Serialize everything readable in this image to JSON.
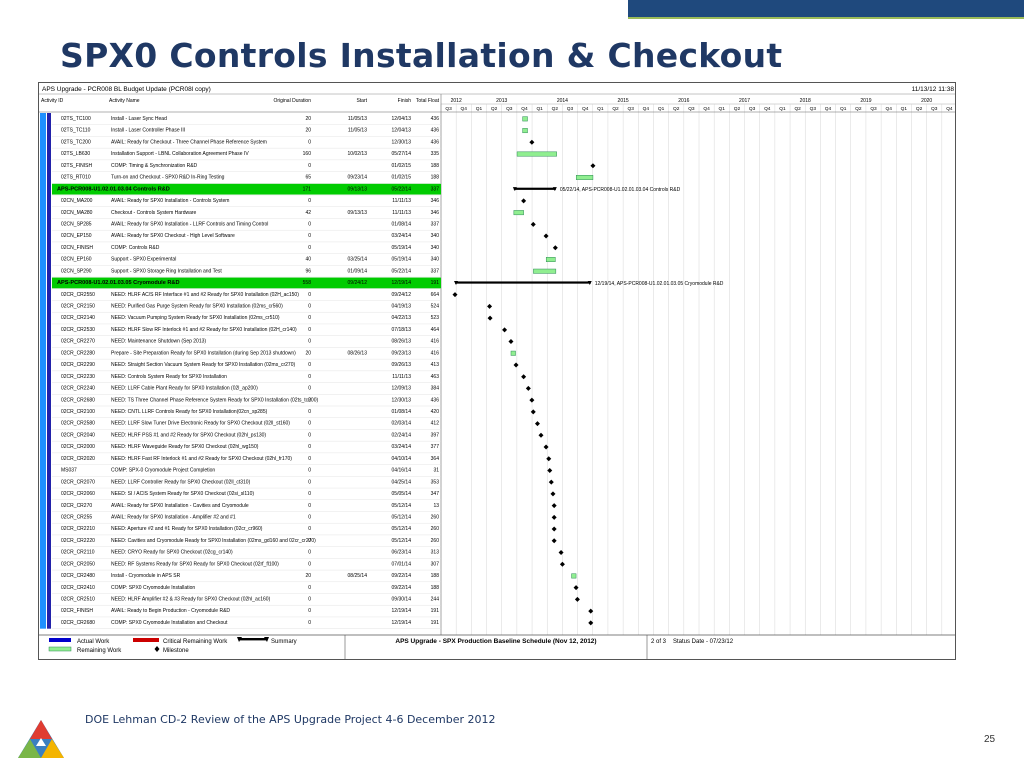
{
  "slide": {
    "title": "SPX0 Controls Installation & Checkout",
    "footer": "DOE Lehman CD-2 Review of the APS Upgrade Project 4-6 December 2012",
    "page_number": "25"
  },
  "schedule": {
    "project_title": "APS Upgrade - PCR008 BL Budget Update (PCR08l copy)",
    "date_printed": "11/13/12 11:38",
    "columns": [
      "Activity ID",
      "Activity Name",
      "Original Duration",
      "Start",
      "Finish",
      "Total Float"
    ],
    "years": [
      "2012",
      "2013",
      "2014",
      "2015",
      "2016",
      "2017",
      "2018",
      "2019",
      "2020"
    ],
    "quarters": [
      "Q3",
      "Q4",
      "Q1",
      "Q2",
      "Q3",
      "Q4",
      "Q1",
      "Q2",
      "Q3",
      "Q4",
      "Q1",
      "Q2",
      "Q3",
      "Q4",
      "Q1",
      "Q2",
      "Q3",
      "Q4",
      "Q1",
      "Q2",
      "Q3",
      "Q4",
      "Q1",
      "Q2",
      "Q3",
      "Q4",
      "Q1",
      "Q2",
      "Q3",
      "Q4",
      "Q1",
      "Q2",
      "Q3",
      "Q4"
    ],
    "rows": [
      {
        "id": "02TS_TC100",
        "name": "Install - Laser Sync Head",
        "dur": "20",
        "start": "11/05/13",
        "finish": "12/04/13",
        "float": "436",
        "kind": "bar"
      },
      {
        "id": "02TS_TC110",
        "name": "Install - Laser Controller Phase III",
        "dur": "20",
        "start": "11/05/13",
        "finish": "12/04/13",
        "float": "436",
        "kind": "bar"
      },
      {
        "id": "02TS_TC200",
        "name": "AVAIL: Ready for Checkout - Three Channel Phase Reference System",
        "dur": "0",
        "start": "",
        "finish": "12/30/13",
        "float": "436",
        "kind": "ms"
      },
      {
        "id": "02TS_LB630",
        "name": "Installation Support - LBNL Collaboration Agreement Phase IV",
        "dur": "160",
        "start": "10/02/13",
        "finish": "05/27/14",
        "float": "335",
        "kind": "bar"
      },
      {
        "id": "02TS_FINISH",
        "name": "COMP: Timing & Synchronization R&D",
        "dur": "0",
        "start": "",
        "finish": "01/02/15",
        "float": "188",
        "kind": "ms"
      },
      {
        "id": "02TS_RT010",
        "name": "Turn-on and Checkout - SPX0 R&D In-Ring Testing",
        "dur": "65",
        "start": "09/23/14",
        "finish": "01/02/15",
        "float": "188",
        "kind": "bar"
      },
      {
        "id": "APS-PCR008-U1.02.01.03.04  Controls R&D",
        "name": "",
        "dur": "171",
        "start": "09/13/13",
        "finish": "05/22/14",
        "float": "337",
        "kind": "summary",
        "note": "05/22/14, APS-PCR008-U1.02.01.03.04  Controls R&D"
      },
      {
        "id": "02CN_MA200",
        "name": "AVAIL: Ready for SPX0 Installation - Controls System",
        "dur": "0",
        "start": "",
        "finish": "11/11/13",
        "float": "346",
        "kind": "ms"
      },
      {
        "id": "02CN_MA280",
        "name": "Checkout - Controls System Hardware",
        "dur": "42",
        "start": "09/13/13",
        "finish": "11/11/13",
        "float": "346",
        "kind": "bar"
      },
      {
        "id": "02CN_SP285",
        "name": "AVAIL: Ready for SPX0 Installation - LLRF Controls and Timing Control",
        "dur": "0",
        "start": "",
        "finish": "01/08/14",
        "float": "337",
        "kind": "ms"
      },
      {
        "id": "02CN_EP150",
        "name": "AVAIL: Ready for SPX0 Checkout - High Level Software",
        "dur": "0",
        "start": "",
        "finish": "03/24/14",
        "float": "340",
        "kind": "ms"
      },
      {
        "id": "02CN_FINISH",
        "name": "COMP: Controls R&D",
        "dur": "0",
        "start": "",
        "finish": "05/19/14",
        "float": "340",
        "kind": "ms"
      },
      {
        "id": "02CN_EP160",
        "name": "Support - SPX0 Experimental",
        "dur": "40",
        "start": "03/25/14",
        "finish": "05/19/14",
        "float": "340",
        "kind": "bar"
      },
      {
        "id": "02CN_SP290",
        "name": "Support - SPX0 Storage Ring Installation and Test",
        "dur": "96",
        "start": "01/09/14",
        "finish": "05/22/14",
        "float": "337",
        "kind": "bar"
      },
      {
        "id": "APS-PCR008-U1.02.01.03.05  Cryomodule R&D",
        "name": "",
        "dur": "558",
        "start": "09/24/12",
        "finish": "12/19/14",
        "float": "191",
        "kind": "summary",
        "note": "12/19/14, APS-PCR008-U1.02.01.03.05  Cryomodule R&D"
      },
      {
        "id": "02CR_CR2550",
        "name": "NEED: HLRF AC/S RF Interface #1 and #2 Ready for SPX0 Installation (02H_ac150)",
        "dur": "0",
        "start": "",
        "finish": "09/24/12",
        "float": "664",
        "kind": "ms"
      },
      {
        "id": "02CR_CR2150",
        "name": "NEED: Purified Gas Purge System Ready for SPX0 Installation (02ms_cr560)",
        "dur": "0",
        "start": "",
        "finish": "04/19/13",
        "float": "524",
        "kind": "ms"
      },
      {
        "id": "02CR_CR2140",
        "name": "NEED: Vacuum Pumping System Ready for SPX0 Installation (02ms_cr510)",
        "dur": "0",
        "start": "",
        "finish": "04/22/13",
        "float": "523",
        "kind": "ms"
      },
      {
        "id": "02CR_CR2530",
        "name": "NEED: HLRF Slow RF Interlock #1 and #2 Ready for SPX0 Installation (02H_cr140)",
        "dur": "0",
        "start": "",
        "finish": "07/18/13",
        "float": "464",
        "kind": "ms"
      },
      {
        "id": "02CR_CR2270",
        "name": "NEED: Maintenance Shutdown (Sep 2013)",
        "dur": "0",
        "start": "",
        "finish": "08/26/13",
        "float": "416",
        "kind": "ms"
      },
      {
        "id": "02CR_CR2280",
        "name": "Prepare - Site Preparation Ready for SPX0 Installation (during Sep 2013 shutdown)",
        "dur": "20",
        "start": "08/26/13",
        "finish": "09/23/13",
        "float": "416",
        "kind": "bar"
      },
      {
        "id": "02CR_CR2290",
        "name": "NEED: Straight Section Vacuum System Ready for SPX0 Installation (02ms_cr270)",
        "dur": "0",
        "start": "",
        "finish": "09/26/13",
        "float": "413",
        "kind": "ms"
      },
      {
        "id": "02CR_CR2230",
        "name": "NEED: Controls System Ready for SPX0 Installation",
        "dur": "0",
        "start": "",
        "finish": "11/11/13",
        "float": "463",
        "kind": "ms"
      },
      {
        "id": "02CR_CR2240",
        "name": "NEED: LLRF Cable Plant Ready for SPX0 Installation (02l_ap200)",
        "dur": "0",
        "start": "",
        "finish": "12/09/13",
        "float": "384",
        "kind": "ms"
      },
      {
        "id": "02CR_CR2680",
        "name": "NEED: TS Three Channel Phase Reference System Ready for SPX0 Installation (02ts_tc200)",
        "dur": "0",
        "start": "",
        "finish": "12/30/13",
        "float": "436",
        "kind": "ms"
      },
      {
        "id": "02CR_CR2100",
        "name": "NEED: CNTL LLRF Controls Ready for SPX0 Installation(02cn_sp285)",
        "dur": "0",
        "start": "",
        "finish": "01/08/14",
        "float": "420",
        "kind": "ms"
      },
      {
        "id": "02CR_CR2580",
        "name": "NEED: LLRF Slow Tuner Drive Electronic Ready for SPX0 Checkout (02ll_st160)",
        "dur": "0",
        "start": "",
        "finish": "02/03/14",
        "float": "412",
        "kind": "ms"
      },
      {
        "id": "02CR_CR2040",
        "name": "NEED: HLRF PSS #1 and #2 Ready for SPX0 Checkout (02hl_ps130)",
        "dur": "0",
        "start": "",
        "finish": "02/24/14",
        "float": "397",
        "kind": "ms"
      },
      {
        "id": "02CR_CR2000",
        "name": "NEED: HLRF Waveguide Ready for SPX0 Checkout (02hl_wg150)",
        "dur": "0",
        "start": "",
        "finish": "03/24/14",
        "float": "377",
        "kind": "ms"
      },
      {
        "id": "02CR_CR2020",
        "name": "NEED: HLRF Fast RF Interlock #1 and #2 Ready for SPX0 Checkout (02hl_fr170)",
        "dur": "0",
        "start": "",
        "finish": "04/10/14",
        "float": "364",
        "kind": "ms"
      },
      {
        "id": "MS037",
        "name": "COMP: SPX-0 Cryomodule Project Completion",
        "dur": "0",
        "start": "",
        "finish": "04/16/14",
        "float": "31",
        "kind": "ms"
      },
      {
        "id": "02CR_CR2070",
        "name": "NEED: LLRF Controller Ready for SPX0 Checkout (02ll_ct310)",
        "dur": "0",
        "start": "",
        "finish": "04/25/14",
        "float": "353",
        "kind": "ms"
      },
      {
        "id": "02CR_CR2060",
        "name": "NEED: SI / ACIS System Ready for SPX0 Checkout (02si_sl110)",
        "dur": "0",
        "start": "",
        "finish": "05/05/14",
        "float": "347",
        "kind": "ms"
      },
      {
        "id": "02CR_CR270",
        "name": "AVAIL: Ready for SPX0 Installation - Cavities and Cryomodule",
        "dur": "0",
        "start": "",
        "finish": "05/12/14",
        "float": "13",
        "kind": "ms"
      },
      {
        "id": "02CR_CR255",
        "name": "AVAIL: Ready for SPX0 Installation - Amplifier #2 and #1",
        "dur": "0",
        "start": "",
        "finish": "05/12/14",
        "float": "260",
        "kind": "ms"
      },
      {
        "id": "02CR_CR2210",
        "name": "NEED: Aperture #2 and #1 Ready for SPX0 Installation (02cr_cr960)",
        "dur": "0",
        "start": "",
        "finish": "05/12/14",
        "float": "260",
        "kind": "ms"
      },
      {
        "id": "02CR_CR2220",
        "name": "NEED: Cavities and Cryomodule Ready for SPX0 Installation (02ms_gd160 and 02cr_cr270)",
        "dur": "0",
        "start": "",
        "finish": "05/12/14",
        "float": "260",
        "kind": "ms"
      },
      {
        "id": "02CR_CR2110",
        "name": "NEED: CRYO Ready for SPX0 Checkout (02cg_cr140)",
        "dur": "0",
        "start": "",
        "finish": "06/23/14",
        "float": "313",
        "kind": "ms"
      },
      {
        "id": "02CR_CR2050",
        "name": "NEED: RF Systems Ready for SPX0 Ready for SPX0 Checkout (02rf_fl100)",
        "dur": "0",
        "start": "",
        "finish": "07/01/14",
        "float": "307",
        "kind": "ms"
      },
      {
        "id": "02CR_CR2480",
        "name": "Install - Cryomodule in APS SR",
        "dur": "20",
        "start": "08/25/14",
        "finish": "09/22/14",
        "float": "188",
        "kind": "bar"
      },
      {
        "id": "02CR_CR2410",
        "name": "COMP: SPX0 Cryomodule Installation",
        "dur": "0",
        "start": "",
        "finish": "09/22/14",
        "float": "188",
        "kind": "ms"
      },
      {
        "id": "02CR_CR2510",
        "name": "NEED: HLRF Amplifier #2 & #3 Ready for SPX0 Checkout (02hl_ac160)",
        "dur": "0",
        "start": "",
        "finish": "09/30/14",
        "float": "244",
        "kind": "ms"
      },
      {
        "id": "02CR_FINISH",
        "name": "AVAIL: Ready to Begin Production - Cryomodule R&D",
        "dur": "0",
        "start": "",
        "finish": "12/19/14",
        "float": "191",
        "kind": "ms"
      },
      {
        "id": "02CR_CR2680",
        "name": "COMP: SPX0 Cryomodule Installation and Checkout",
        "dur": "0",
        "start": "",
        "finish": "12/19/14",
        "float": "191",
        "kind": "ms"
      }
    ],
    "legend": {
      "actual_work": "Actual Work",
      "critical_remaining": "Critical Remaining Work",
      "summary": "Summary",
      "remaining_work": "Remaining Work",
      "milestone": "Milestone",
      "schedule_caption": "APS Upgrade - SPX Production Baseline Schedule (Nov 12, 2012)",
      "page_of": "2 of 3",
      "status_date": "Status Date - 07/23/12"
    },
    "colors": {
      "bar_fill": "#90ee90",
      "bar_stroke": "#2e8b57",
      "summary_row": "#00cc00",
      "left_stripe": "#1e90ff",
      "actual_work": "#0000cc",
      "critical": "#cc0000"
    }
  }
}
